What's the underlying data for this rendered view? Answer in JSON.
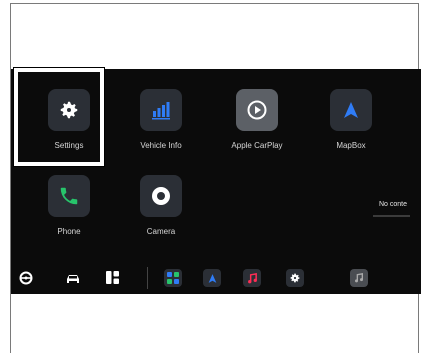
{
  "apps": [
    {
      "label": "Settings",
      "icon": "gear-icon"
    },
    {
      "label": "Vehicle Info",
      "icon": "bar-chart-icon"
    },
    {
      "label": "Apple CarPlay",
      "icon": "carplay-icon"
    },
    {
      "label": "MapBox",
      "icon": "navigation-arrow-icon"
    },
    {
      "label": "Phone",
      "icon": "phone-icon"
    },
    {
      "label": "Camera",
      "icon": "camera-icon"
    }
  ],
  "dock": {
    "items": [
      "steering-wheel-icon",
      "car-icon",
      "apps-grid-icon",
      "multi-app-icon",
      "navigation-arrow-icon",
      "music-icon",
      "gear-icon",
      "music-note-icon"
    ],
    "now_playing": "No conte"
  },
  "colors": {
    "accent_blue": "#2f7cf6",
    "green": "#27c46b",
    "music_red": "#ff2d55",
    "background": "#0b0b0b"
  }
}
